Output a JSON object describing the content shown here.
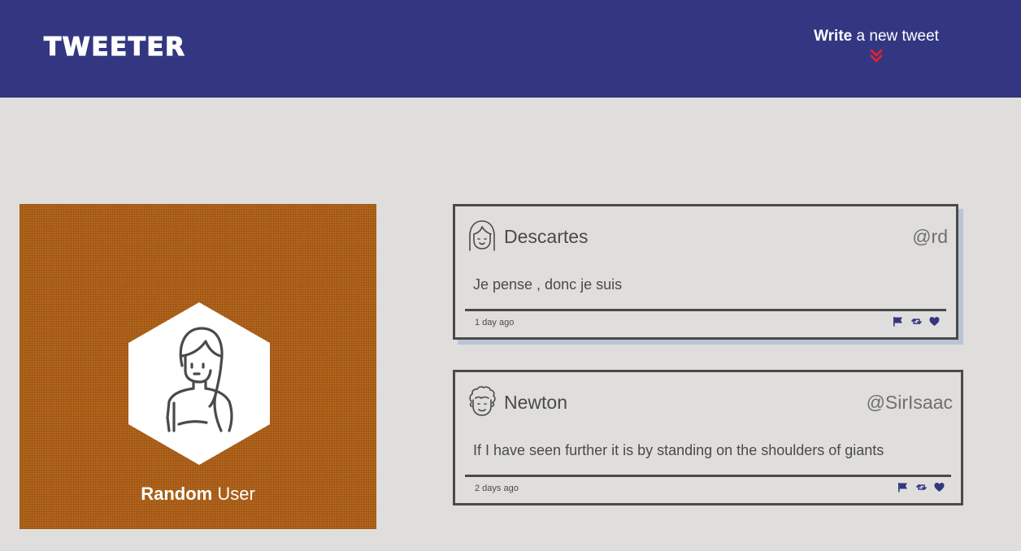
{
  "header": {
    "logo": "TWEETER",
    "compose_bold": "Write",
    "compose_rest": " a new tweet",
    "compose_icon": "double-chevron-down-icon",
    "accent_color": "#e8202b",
    "nav_color": "#333781"
  },
  "profile": {
    "name_first": "Random",
    "name_last": " User",
    "avatar_icon": "user-avatar-icon"
  },
  "tweets": [
    {
      "name": "Descartes",
      "handle": "@rd",
      "content": "Je pense , donc je suis",
      "time": "1 day ago",
      "avatar_icon": "girl-avatar-icon"
    },
    {
      "name": "Newton",
      "handle": "@SirIsaac",
      "content": "If I have seen further it is by standing on the shoulders of giants",
      "time": "2 days ago",
      "avatar_icon": "curly-hair-avatar-icon"
    }
  ],
  "actions": {
    "flag_icon": "flag-icon",
    "retweet_icon": "retweet-icon",
    "like_icon": "heart-icon",
    "color": "#333781"
  }
}
